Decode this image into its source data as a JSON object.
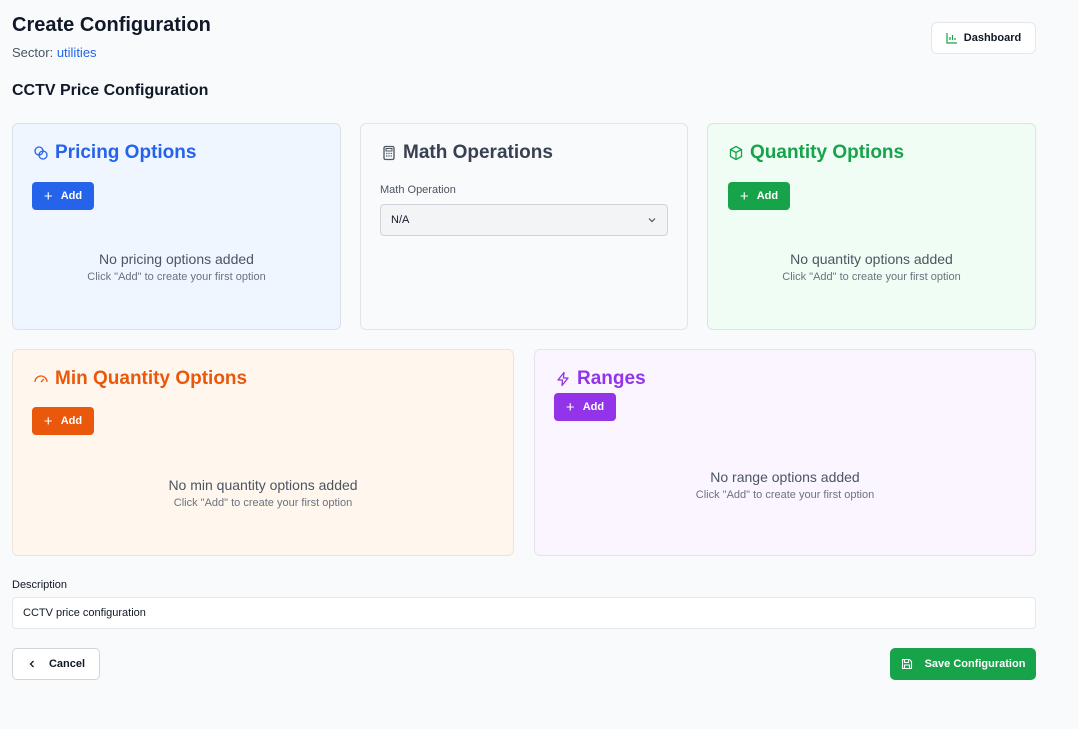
{
  "header": {
    "title": "Create Configuration",
    "sector_label": "Sector:",
    "sector_value": "utilities",
    "dashboard_label": "Dashboard"
  },
  "section_title": "CCTV Price Configuration",
  "cards": {
    "pricing": {
      "title": "Pricing Options",
      "add_label": "Add",
      "empty_main": "No pricing options added",
      "empty_sub": "Click \"Add\" to create your first option",
      "color": "#2563eb"
    },
    "math": {
      "title": "Math Operations",
      "field_label": "Math Operation",
      "selected": "N/A",
      "color": "#374151"
    },
    "quantity": {
      "title": "Quantity Options",
      "add_label": "Add",
      "empty_main": "No quantity options added",
      "empty_sub": "Click \"Add\" to create your first option",
      "color": "#16a34a"
    },
    "min_quantity": {
      "title": "Min Quantity Options",
      "add_label": "Add",
      "empty_main": "No min quantity options added",
      "empty_sub": "Click \"Add\" to create your first option",
      "color": "#ea580c"
    },
    "ranges": {
      "title": "Ranges",
      "add_label": "Add",
      "empty_main": "No range options added",
      "empty_sub": "Click \"Add\" to create your first option",
      "color": "#9333ea"
    }
  },
  "description": {
    "label": "Description",
    "value": "CCTV price configuration"
  },
  "footer": {
    "cancel_label": "Cancel",
    "save_label": "Save Configuration"
  },
  "icons": {
    "dashboard": "bar-chart-icon",
    "pricing": "coins-icon",
    "math": "calculator-icon",
    "quantity": "package-icon",
    "min_quantity": "gauge-icon",
    "ranges": "zap-icon",
    "cancel": "chevron-left-icon",
    "save": "save-icon"
  }
}
